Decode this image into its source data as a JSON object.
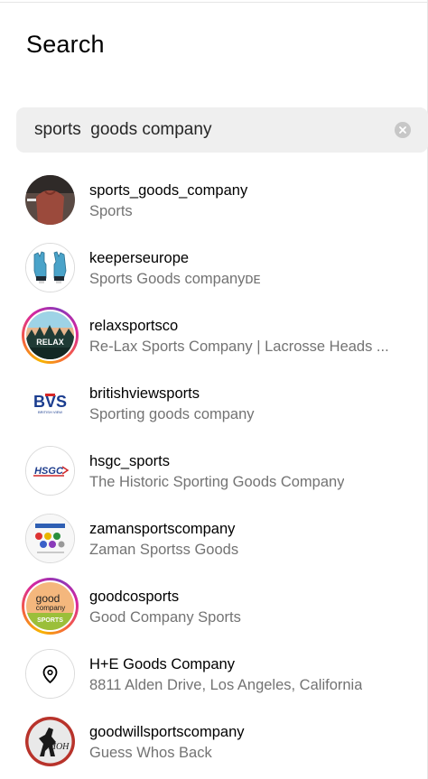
{
  "page": {
    "title": "Search"
  },
  "search": {
    "value": "sports  goods company",
    "clear_icon": "clear-circle-x-icon"
  },
  "results": [
    {
      "username": "sports_goods_company",
      "subtitle": "Sports"
    },
    {
      "username": "keeperseurope",
      "subtitle": "Sports Goods companyᴅᴇ"
    },
    {
      "username": "relaxsportsco",
      "subtitle": "Re-Lax Sports Company | Lacrosse Heads ..."
    },
    {
      "username": "britishviewsports",
      "subtitle": "Sporting goods company"
    },
    {
      "username": "hsgc_sports",
      "subtitle": "The Historic Sporting Goods Company"
    },
    {
      "username": "zamansportscompany",
      "subtitle": "Zaman Sportss Goods"
    },
    {
      "username": "goodcosports",
      "subtitle": "Good Company Sports"
    },
    {
      "username": "H+E Goods Company",
      "subtitle": "8811 Alden Drive, Los Angeles, California"
    },
    {
      "username": "goodwillsportscompany",
      "subtitle": "Guess Whos Back"
    }
  ],
  "logo_text": {
    "bvs": "BVS",
    "bvs_small": "BRITISH VIEW",
    "hsgc": "HSGC",
    "good": "good",
    "company": "company",
    "sports": "SPORTS",
    "relax": "RELAX",
    "moh": "MOH"
  },
  "colors": {
    "story_ring": [
      "#f7b500",
      "#f56040",
      "#d6249f",
      "#8a3ab9"
    ],
    "subtitle_text": "#737373",
    "search_bg": "#efefef"
  }
}
